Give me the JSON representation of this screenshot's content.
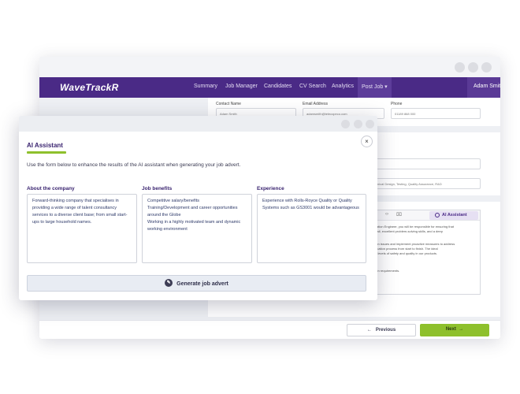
{
  "app": {
    "logo": "WaveTrackR",
    "nav": [
      "Summary",
      "Job Manager",
      "Candidates",
      "CV Search",
      "Analytics",
      "Post Job ▾"
    ],
    "user": "Adam Smith"
  },
  "form": {
    "contact_name_label": "Contact Name",
    "contact_name_value": "Adam Smith",
    "email_label": "Email Address",
    "email_value": "adamsmith@telecopeco.com",
    "phone_label": "Phone",
    "phone_value": "01189 868 000",
    "skills_value": "nical Design, Testing, Quality Assurance, R&D",
    "editor_lines": [
      "ification Engineer, you will be responsible for ensuring that",
      "detail, excellent problem-solving skills, and a deep",
      "ation issues and implement proactive measures to address",
      "rtification process from start to finish. The ideal",
      "est levels of safety and quality in our products.",
      "ntain requirements."
    ],
    "ai_button": "AI Assistant",
    "previous_label": "Previous",
    "next_label": "Next"
  },
  "modal": {
    "title": "AI Assistant",
    "close": "×",
    "instructions": "Use the form below to enhance the results of the AI assistant when generating your job advert.",
    "columns": [
      {
        "label": "About the company",
        "text": "Forward-thinking company that specialises in providing a wide range of talent consultancy services to a diverse client base; from small start-ups to large household names."
      },
      {
        "label": "Job benefits",
        "text": "Competitive salary/benefits\nTraining/Development and career opportunities around the Globe\nWorking in a highly motivated team and dynamic working environment"
      },
      {
        "label": "Experience",
        "text": "Experience with Rolls-Royce Quality or Quality Systems such as GS3001 would be advantageous"
      }
    ],
    "generate_label": "Generate job advert"
  },
  "colors": {
    "brand_purple": "#4a2a86",
    "accent_green": "#8ec02c"
  }
}
